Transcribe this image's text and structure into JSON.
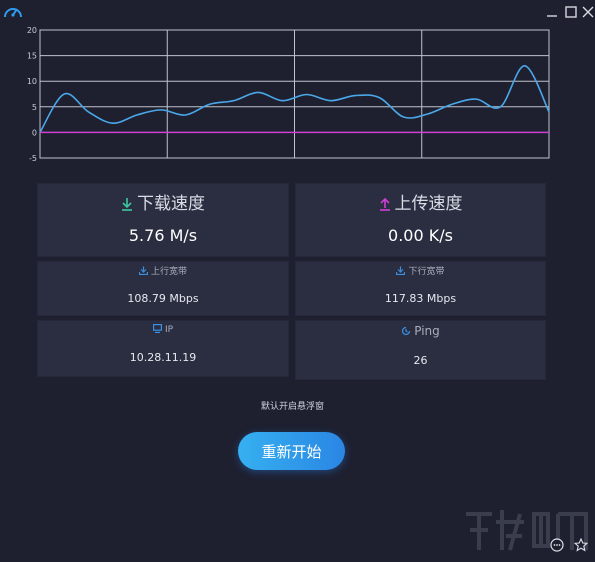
{
  "window": {
    "logo_icon": "speedometer-icon",
    "controls": [
      "minimize-icon",
      "maximize-icon",
      "close-icon"
    ]
  },
  "chart_data": {
    "type": "line",
    "ylim": [
      -5,
      20
    ],
    "yticks": [
      "20",
      "15",
      "10",
      "5",
      "0",
      "-5"
    ],
    "grid": true,
    "series": [
      {
        "color": "#4aa8ea",
        "values": [
          0,
          7.5,
          4,
          1.8,
          3.4,
          4.4,
          3.4,
          5.5,
          6.2,
          7.8,
          6.2,
          7.4,
          6.2,
          7.2,
          6.8,
          3.0,
          3.6,
          5.5,
          6.5,
          5.0,
          13.0,
          4.0
        ]
      },
      {
        "color": "#d13fd6",
        "values": [
          0,
          0
        ]
      }
    ]
  },
  "download": {
    "title": "下载速度",
    "value": "5.76 M/s",
    "icon": "download-arrow-icon",
    "color": "#3dc9a0"
  },
  "upload": {
    "title": "上传速度",
    "value": "0.00 K/s",
    "icon": "upload-arrow-icon",
    "color": "#d13fd6"
  },
  "up_bandwidth": {
    "title": "上行宽带",
    "value": "108.79 Mbps",
    "icon": "download-tray-icon"
  },
  "down_bandwidth": {
    "title": "下行宽带",
    "value": "117.83 Mbps",
    "icon": "download-tray-icon"
  },
  "ip": {
    "title": "IP",
    "value": "10.28.11.19",
    "icon": "monitor-icon"
  },
  "ping": {
    "title": "Ping",
    "value": "26",
    "icon": "clock-icon"
  },
  "float_window_label": "默认开启悬浮窗",
  "restart_label": "重新开始",
  "accent": "#2f9bec",
  "corner_icons": [
    "dots-circle-icon",
    "star-icon"
  ]
}
